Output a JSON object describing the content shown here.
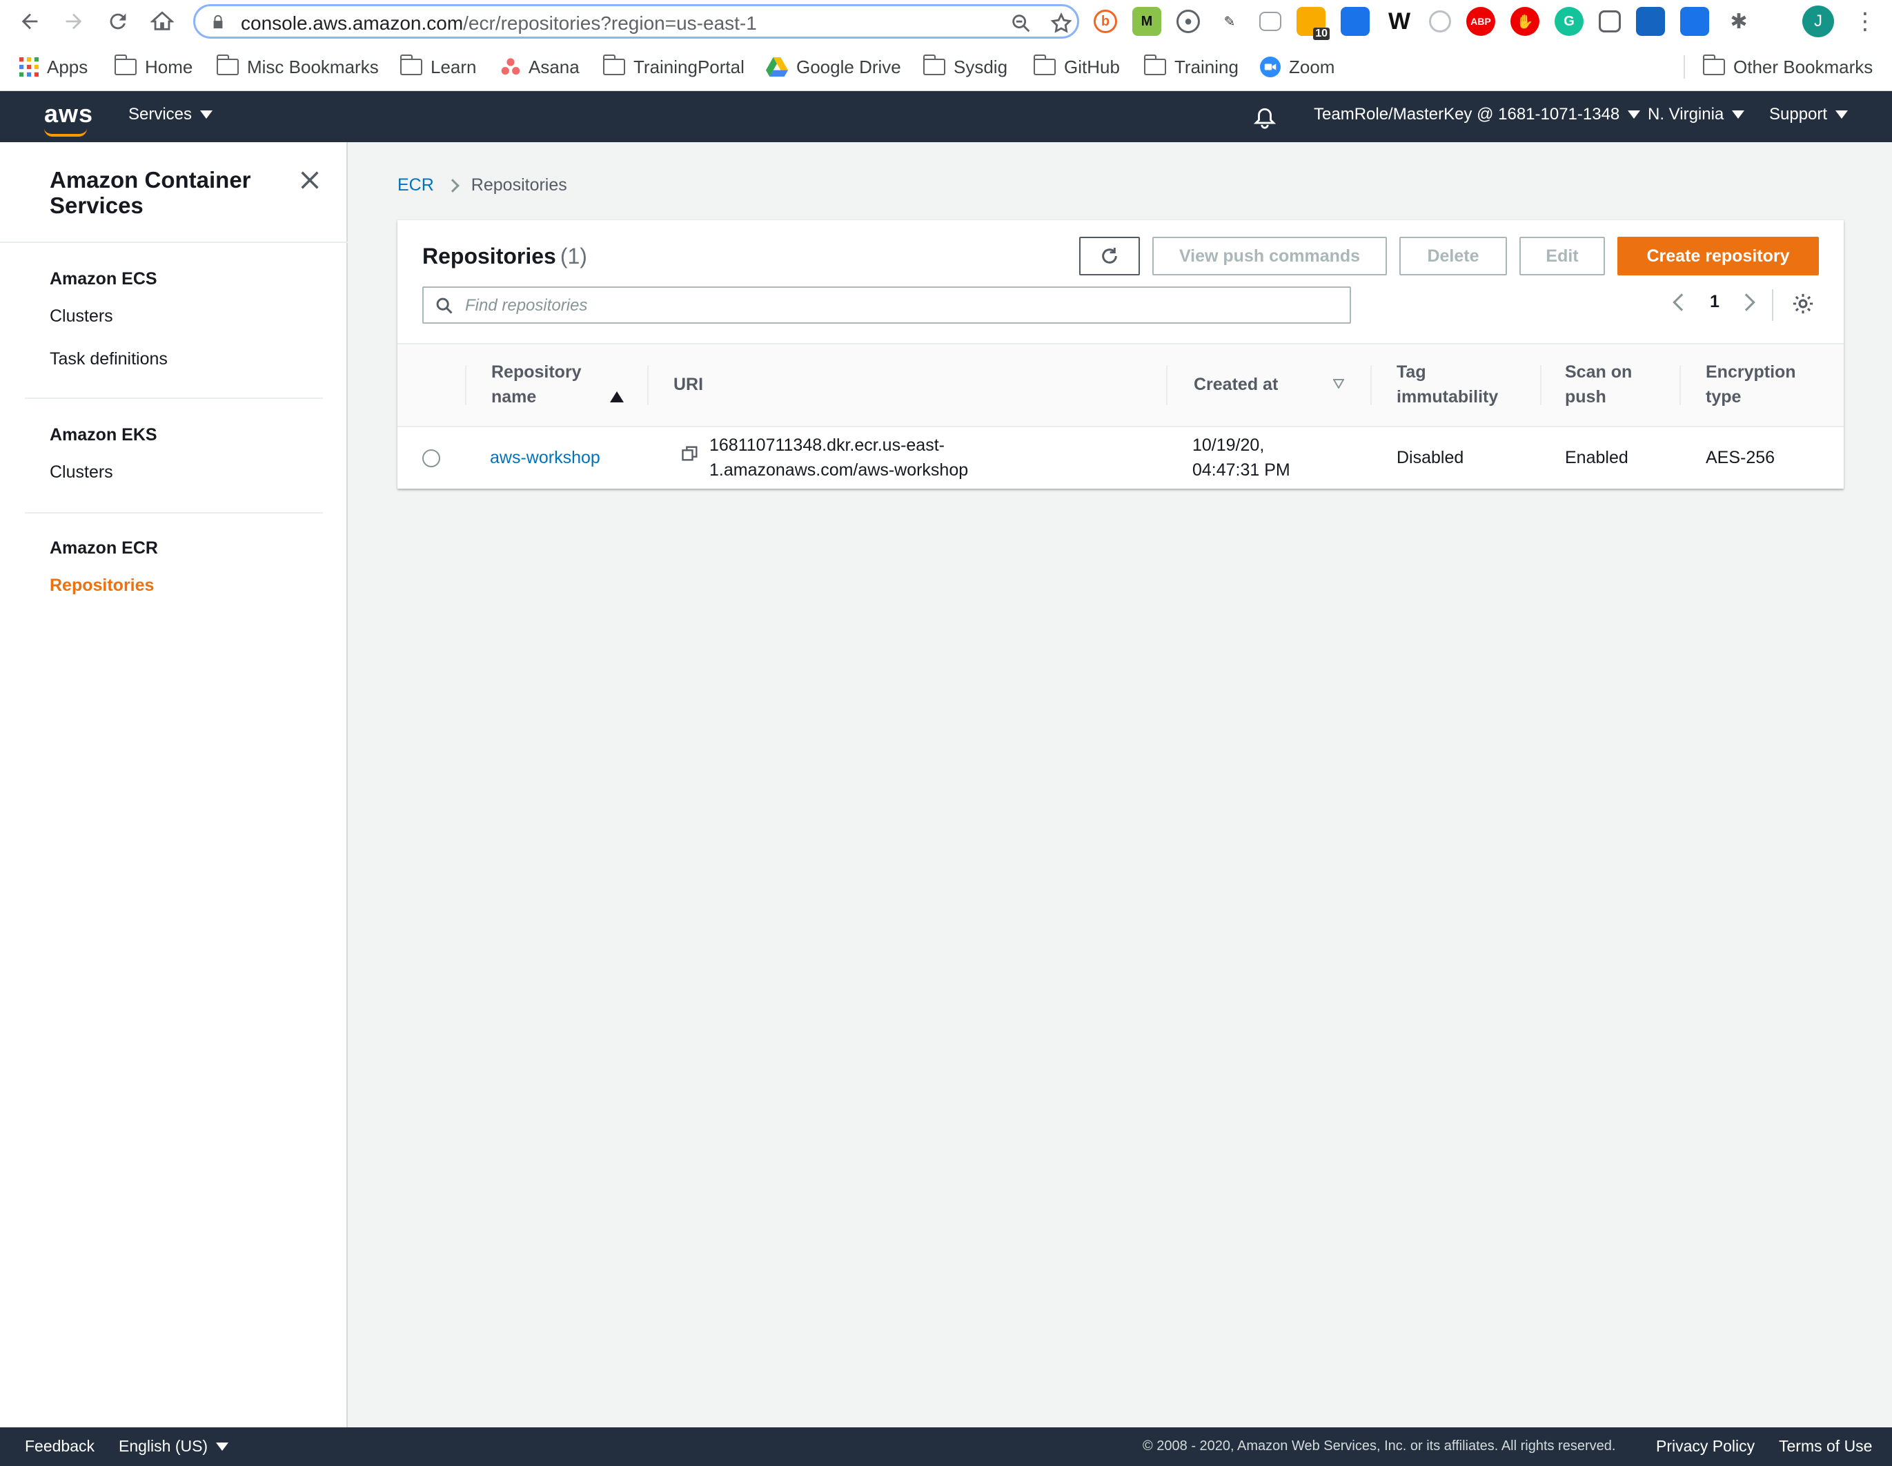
{
  "browser": {
    "url_host": "console.aws.amazon.com",
    "url_path": "/ecr/repositories?region=us-east-1",
    "avatar_letter": "J",
    "ext_badge": "10",
    "ext_abp": "ABP",
    "ext_m": "M",
    "ext_w": "W"
  },
  "bookmarks": {
    "apps": "Apps",
    "items": [
      "Home",
      "Misc Bookmarks",
      "Learn",
      "Asana",
      "TrainingPortal",
      "Google Drive",
      "Sysdig",
      "GitHub",
      "Training",
      "Zoom"
    ],
    "other": "Other Bookmarks"
  },
  "aws_header": {
    "logo": "aws",
    "services": "Services",
    "account": "TeamRole/MasterKey @ 1681-1071-1348",
    "region": "N. Virginia",
    "support": "Support"
  },
  "sidebar": {
    "title": "Amazon Container Services",
    "sections": [
      {
        "heading": "Amazon ECS",
        "links": [
          "Clusters",
          "Task definitions"
        ]
      },
      {
        "heading": "Amazon EKS",
        "links": [
          "Clusters"
        ]
      },
      {
        "heading": "Amazon ECR",
        "links": [
          "Repositories"
        ]
      }
    ]
  },
  "breadcrumb": {
    "root": "ECR",
    "current": "Repositories"
  },
  "panel": {
    "title": "Repositories",
    "count": "(1)",
    "buttons": {
      "view_push": "View push commands",
      "delete": "Delete",
      "edit": "Edit",
      "create": "Create repository"
    },
    "search_placeholder": "Find repositories",
    "page": "1"
  },
  "table": {
    "columns": {
      "name_line1": "Repository",
      "name_line2": "name",
      "uri": "URI",
      "created": "Created at",
      "tag_line1": "Tag",
      "tag_line2": "immutability",
      "scan_line1": "Scan on",
      "scan_line2": "push",
      "enc_line1": "Encryption",
      "enc_line2": "type"
    },
    "rows": [
      {
        "name": "aws-workshop",
        "uri_line1": "168110711348.dkr.ecr.us-east-",
        "uri_line2": "1.amazonaws.com/aws-workshop",
        "created_line1": "10/19/20,",
        "created_line2": "04:47:31 PM",
        "tag_immutability": "Disabled",
        "scan_on_push": "Enabled",
        "encryption": "AES-256"
      }
    ]
  },
  "footer": {
    "feedback": "Feedback",
    "language": "English (US)",
    "copyright": "© 2008 - 2020, Amazon Web Services, Inc. or its affiliates. All rights reserved.",
    "privacy": "Privacy Policy",
    "terms": "Terms of Use"
  },
  "colors": {
    "aws_nav": "#232f3e",
    "accent_orange": "#ec7211",
    "link_blue": "#0073bb"
  }
}
